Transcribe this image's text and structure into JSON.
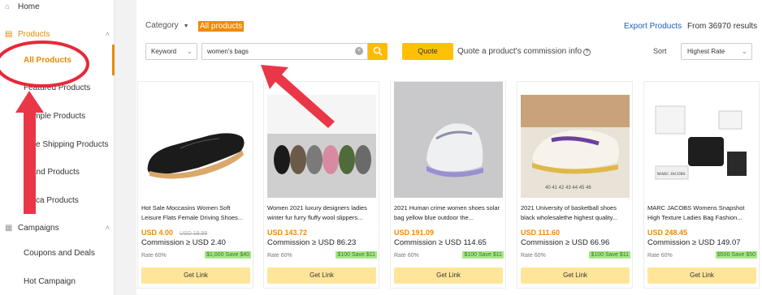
{
  "sidebar": {
    "home": "Home",
    "products": "Products",
    "items": [
      "All Products",
      "Featured Products",
      "Sample Products",
      "Free Shipping Products",
      "Brand Products",
      "Africa Products"
    ],
    "campaigns": "Campaigns",
    "campaign_items": [
      "Coupons and Deals",
      "Hot Campaign"
    ]
  },
  "filters": {
    "category_label": "Category",
    "category_value": "All products",
    "export": "Export Products",
    "results": "From 36970 results",
    "keyword_select": "Keyword",
    "search_value": "women's bags",
    "quote_button": "Quote",
    "quote_info": "Quote a product's commission info",
    "sort_label": "Sort",
    "sort_value": "Highest Rate"
  },
  "accent_color": "#f08a00",
  "products": [
    {
      "title": "Hot Sale Moccasins Women Soft Leisure Flats Female Driving Shoes...",
      "price": "USD 4.00",
      "old_price": "USD 19.99",
      "commission": "Commission ≥ USD 2.40",
      "rate": "Rate 60%",
      "promo": "$1,000 Save $40",
      "get_link": "Get Link"
    },
    {
      "title": "Women 2021 luxury designers ladies winter fur furry fluffy wool slippers...",
      "price": "USD 143.72",
      "old_price": "",
      "commission": "Commission ≥ USD 86.23",
      "rate": "Rate 60%",
      "promo": "$100 Save $11",
      "get_link": "Get Link"
    },
    {
      "title": "2021 Human crime women shoes solar bag yellow blue outdoor the...",
      "price": "USD 191.09",
      "old_price": "",
      "commission": "Commission ≥ USD 114.65",
      "rate": "Rate 60%",
      "promo": "$100 Save $11",
      "get_link": "Get Link"
    },
    {
      "title": "2021 University of basketball shoes black wholesalethe highest quality...",
      "price": "USD 111.60",
      "old_price": "",
      "commission": "Commission ≥ USD 66.96",
      "rate": "Rate 60%",
      "promo": "$100 Save $11",
      "get_link": "Get Link"
    },
    {
      "title": "MARC JACOBS Womens Snapshot High Texture Ladies Bag Fashion...",
      "price": "USD 248.45",
      "old_price": "",
      "commission": "Commission ≥ USD 149.07",
      "rate": "Rate 60%",
      "promo": "$500 Save $50",
      "get_link": "Get Link"
    }
  ]
}
